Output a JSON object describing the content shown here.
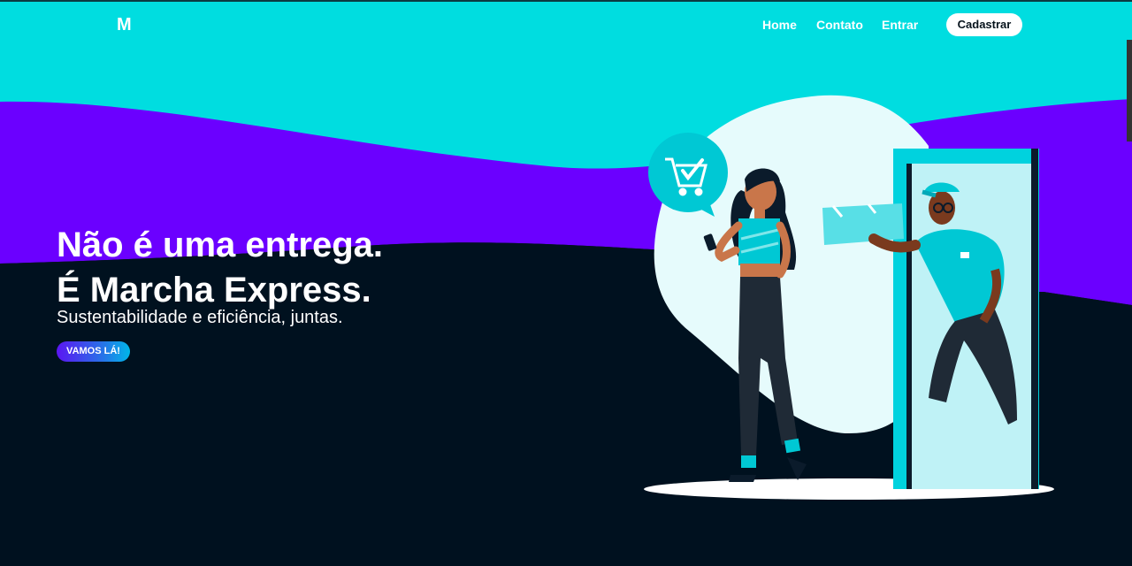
{
  "header": {
    "logo": "M",
    "nav": [
      "Home",
      "Contato",
      "Entrar"
    ],
    "cta": "Cadastrar"
  },
  "hero": {
    "title_line1": "Não é uma entrega.",
    "title_line2": "É Marcha Express.",
    "subtitle": "Sustentabilidade e eficiência, juntas.",
    "button": "VAMOS LÁ!"
  },
  "colors": {
    "cyan": "#00dde0",
    "purple": "#6b00ff",
    "dark": "#00111f",
    "white": "#ffffff"
  },
  "icons": [
    "shopping-cart-icon",
    "checkmark-icon"
  ]
}
